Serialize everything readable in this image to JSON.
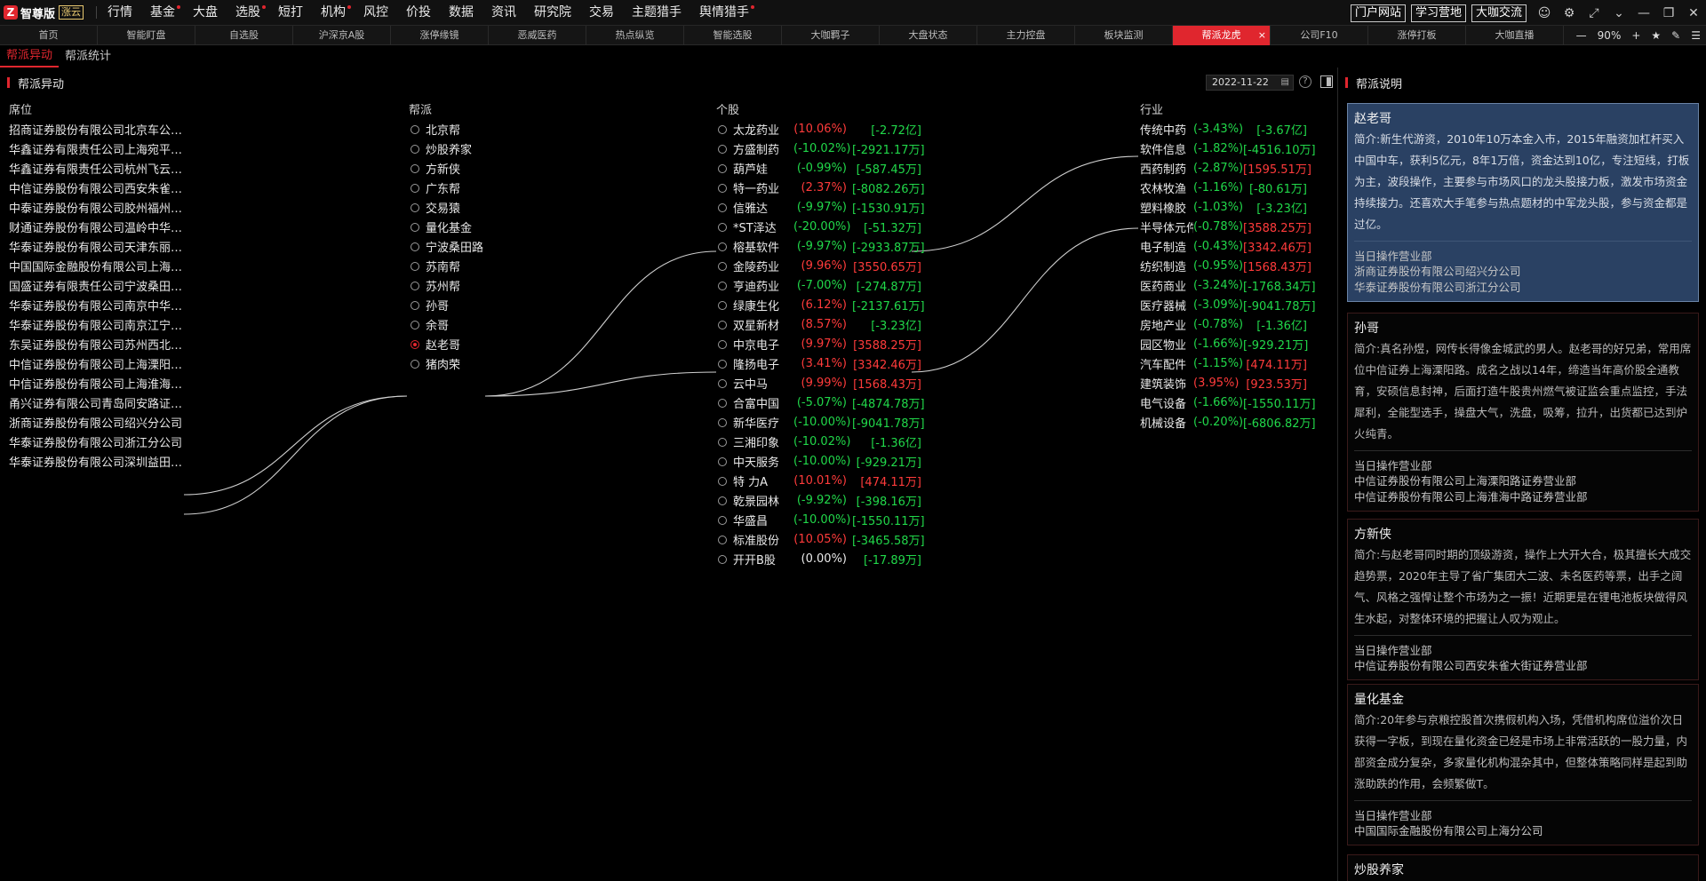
{
  "app": {
    "name": "智尊版",
    "badge": "涨云"
  },
  "menu": [
    {
      "label": "行情",
      "dot": false
    },
    {
      "label": "基金",
      "dot": true
    },
    {
      "label": "大盘",
      "dot": false
    },
    {
      "label": "选股",
      "dot": true
    },
    {
      "label": "短打",
      "dot": false
    },
    {
      "label": "机构",
      "dot": true
    },
    {
      "label": "风控",
      "dot": false
    },
    {
      "label": "价投",
      "dot": false
    },
    {
      "label": "数据",
      "dot": false
    },
    {
      "label": "资讯",
      "dot": false
    },
    {
      "label": "研究院",
      "dot": false
    },
    {
      "label": "交易",
      "dot": false
    },
    {
      "label": "主题猎手",
      "dot": false
    },
    {
      "label": "舆情猎手",
      "dot": true
    }
  ],
  "top_links": [
    "门户网站",
    "学习营地",
    "大咖交流"
  ],
  "tabs": [
    "首页",
    "智能盯盘",
    "自选股",
    "沪深京A股",
    "涨停缘镜",
    "恶威医药",
    "热点纵览",
    "智能选股",
    "大咖羁子",
    "大盘状态",
    "主力控盘",
    "板块监测",
    "帮派龙虎",
    "公司F10",
    "涨停打板",
    "大咖直播"
  ],
  "active_tab": "帮派龙虎",
  "zoom": "90%",
  "subtabs": [
    "帮派异动",
    "帮派统计"
  ],
  "left_panel": {
    "title": "帮派异动",
    "date": "2022-11-22"
  },
  "columns": {
    "seat": "席位",
    "gang": "帮派",
    "stock": "个股",
    "industry": "行业"
  },
  "seats": [
    "招商证券股份有限公司北京车公庄西路证券营业部",
    "华鑫证券有限责任公司上海宛平南路证券营业部",
    "华鑫证券有限责任公司杭州飞云江路证券营业部",
    "中信证券股份有限公司西安朱雀大街证券营业部",
    "中泰证券股份有限公司胶州福州支路证券营业部",
    "财通证券股份有限公司温岭中华路证券营业部",
    "华泰证券股份有限公司天津东丽开发区二纬路证券营业部",
    "中国国际金融股份有限公司上海分公司",
    "国盛证券有限责任公司宁波桑田路证券营业部",
    "华泰证券股份有限公司南京中华路证券营业部",
    "华泰证券股份有限公司南京江宁天元东路证券营业部",
    "东吴证券股份有限公司苏州西北街证券营业部",
    "中信证券股份有限公司上海溧阳路证券营业部",
    "中信证券股份有限公司上海淮海中路证券营业部",
    "甬兴证券有限公司青岛同安路证券营业部",
    "浙商证券股份有限公司绍兴分公司",
    "华泰证券股份有限公司浙江分公司",
    "华泰证券股份有限公司深圳益田路荣超商务中心证券营业部"
  ],
  "gangs": [
    "北京帮",
    "炒股养家",
    "方新侠",
    "广东帮",
    "交易猿",
    "量化基金",
    "宁波桑田路",
    "苏南帮",
    "苏州帮",
    "孙哥",
    "余哥",
    "赵老哥",
    "猪肉荣"
  ],
  "selected_gang": "赵老哥",
  "stocks": [
    {
      "name": "太龙药业",
      "pct": "(10.06%)",
      "amt": "[-2.72亿]",
      "pc": "red",
      "ac": "green"
    },
    {
      "name": "方盛制药",
      "pct": "(-10.02%)",
      "amt": "[-2921.17万]",
      "pc": "green",
      "ac": "green"
    },
    {
      "name": "葫芦娃",
      "pct": "(-0.99%)",
      "amt": "[-587.45万]",
      "pc": "green",
      "ac": "green"
    },
    {
      "name": "特一药业",
      "pct": "(2.37%)",
      "amt": "[-8082.26万]",
      "pc": "red",
      "ac": "green"
    },
    {
      "name": "信雅达",
      "pct": "(-9.97%)",
      "amt": "[-1530.91万]",
      "pc": "green",
      "ac": "green"
    },
    {
      "name": "*ST泽达",
      "pct": "(-20.00%)",
      "amt": "[-51.32万]",
      "pc": "green",
      "ac": "green"
    },
    {
      "name": "榕基软件",
      "pct": "(-9.97%)",
      "amt": "[-2933.87万]",
      "pc": "green",
      "ac": "green"
    },
    {
      "name": "金陵药业",
      "pct": "(9.96%)",
      "amt": "[3550.65万]",
      "pc": "red",
      "ac": "red"
    },
    {
      "name": "亨迪药业",
      "pct": "(-7.00%)",
      "amt": "[-274.87万]",
      "pc": "green",
      "ac": "green"
    },
    {
      "name": "绿康生化",
      "pct": "(6.12%)",
      "amt": "[-2137.61万]",
      "pc": "red",
      "ac": "green"
    },
    {
      "name": "双星新材",
      "pct": "(8.57%)",
      "amt": "[-3.23亿]",
      "pc": "red",
      "ac": "green"
    },
    {
      "name": "中京电子",
      "pct": "(9.97%)",
      "amt": "[3588.25万]",
      "pc": "red",
      "ac": "red"
    },
    {
      "name": "隆扬电子",
      "pct": "(3.41%)",
      "amt": "[3342.46万]",
      "pc": "red",
      "ac": "red"
    },
    {
      "name": "云中马",
      "pct": "(9.99%)",
      "amt": "[1568.43万]",
      "pc": "red",
      "ac": "red"
    },
    {
      "name": "合富中国",
      "pct": "(-5.07%)",
      "amt": "[-4874.78万]",
      "pc": "green",
      "ac": "green"
    },
    {
      "name": "新华医疗",
      "pct": "(-10.00%)",
      "amt": "[-9041.78万]",
      "pc": "green",
      "ac": "green"
    },
    {
      "name": "三湘印象",
      "pct": "(-10.02%)",
      "amt": "[-1.36亿]",
      "pc": "green",
      "ac": "green"
    },
    {
      "name": "中天服务",
      "pct": "(-10.00%)",
      "amt": "[-929.21万]",
      "pc": "green",
      "ac": "green"
    },
    {
      "name": "特 力A",
      "pct": "(10.01%)",
      "amt": "[474.11万]",
      "pc": "red",
      "ac": "red"
    },
    {
      "name": "乾景园林",
      "pct": "(-9.92%)",
      "amt": "[-398.16万]",
      "pc": "green",
      "ac": "green"
    },
    {
      "name": "华盛昌",
      "pct": "(-10.00%)",
      "amt": "[-1550.11万]",
      "pc": "green",
      "ac": "green"
    },
    {
      "name": "标准股份",
      "pct": "(10.05%)",
      "amt": "[-3465.58万]",
      "pc": "red",
      "ac": "green"
    },
    {
      "name": "开开B股",
      "pct": "(0.00%)",
      "amt": "[-17.89万]",
      "pc": "white",
      "ac": "green"
    }
  ],
  "industries": [
    {
      "name": "传统中药",
      "pct": "(-3.43%)",
      "amt": "[-3.67亿]",
      "pc": "green",
      "ac": "green"
    },
    {
      "name": "软件信息",
      "pct": "(-1.82%)",
      "amt": "[-4516.10万]",
      "pc": "green",
      "ac": "green"
    },
    {
      "name": "西药制药",
      "pct": "(-2.87%)",
      "amt": "[1595.51万]",
      "pc": "green",
      "ac": "red"
    },
    {
      "name": "农林牧渔",
      "pct": "(-1.16%)",
      "amt": "[-80.61万]",
      "pc": "green",
      "ac": "green"
    },
    {
      "name": "塑料橡胶",
      "pct": "(-1.03%)",
      "amt": "[-3.23亿]",
      "pc": "green",
      "ac": "green"
    },
    {
      "name": "半导体元件",
      "pct": "(-0.78%)",
      "amt": "[3588.25万]",
      "pc": "green",
      "ac": "red"
    },
    {
      "name": "电子制造",
      "pct": "(-0.43%)",
      "amt": "[3342.46万]",
      "pc": "green",
      "ac": "red"
    },
    {
      "name": "纺织制造",
      "pct": "(-0.95%)",
      "amt": "[1568.43万]",
      "pc": "green",
      "ac": "red"
    },
    {
      "name": "医药商业",
      "pct": "(-3.24%)",
      "amt": "[-1768.34万]",
      "pc": "green",
      "ac": "green"
    },
    {
      "name": "医疗器械",
      "pct": "(-3.09%)",
      "amt": "[-9041.78万]",
      "pc": "green",
      "ac": "green"
    },
    {
      "name": "房地产业",
      "pct": "(-0.78%)",
      "amt": "[-1.36亿]",
      "pc": "green",
      "ac": "green"
    },
    {
      "name": "园区物业",
      "pct": "(-1.66%)",
      "amt": "[-929.21万]",
      "pc": "green",
      "ac": "green"
    },
    {
      "name": "汽车配件",
      "pct": "(-1.15%)",
      "amt": "[474.11万]",
      "pc": "green",
      "ac": "red"
    },
    {
      "name": "建筑装饰",
      "pct": "(3.95%)",
      "amt": "[923.53万]",
      "pc": "red",
      "ac": "red"
    },
    {
      "name": "电气设备",
      "pct": "(-1.66%)",
      "amt": "[-1550.11万]",
      "pc": "green",
      "ac": "green"
    },
    {
      "name": "机械设备",
      "pct": "(-0.20%)",
      "amt": "[-6806.82万]",
      "pc": "green",
      "ac": "green"
    }
  ],
  "right_panel": {
    "title": "帮派说明"
  },
  "cards": [
    {
      "name": "赵老哥",
      "desc": "简介:新生代游资，2010年10万本金入市，2015年融资加杠杆买入中国中车，获利5亿元，8年1万倍，资金达到10亿，专注短线，打板为主，波段操作，主要参与市场风口的龙头股接力板，激发市场资金持续接力。还喜欢大手笔参与热点题材的中军龙头股，参与资金都是过亿。",
      "sub": "当日操作营业部",
      "depts": [
        "浙商证券股份有限公司绍兴分公司",
        "华泰证券股份有限公司浙江分公司"
      ]
    },
    {
      "name": "孙哥",
      "desc": "简介:真名孙煜，网传长得像金城武的男人。赵老哥的好兄弟，常用席位中信证券上海溧阳路。成名之战以14年，缔造当年高价股全通教育，安硕信息封神，后面打造牛股贵州燃气被证监会重点监控，手法犀利，全能型选手，操盘大气，洗盘，吸筹，拉升，出货都已达到炉火纯青。",
      "sub": "当日操作营业部",
      "depts": [
        "中信证券股份有限公司上海溧阳路证券营业部",
        "中信证券股份有限公司上海淮海中路证券营业部"
      ]
    },
    {
      "name": "方新侠",
      "desc": "简介:与赵老哥同时期的顶级游资，操作上大开大合，极其擅长大成交趋势票，2020年主导了省广集团大二波、未名医药等票，出手之阔气、风格之强悍让整个市场为之一振！近期更是在锂电池板块做得风生水起，对整体环境的把握让人叹为观止。",
      "sub": "当日操作营业部",
      "depts": [
        "中信证券股份有限公司西安朱雀大街证券营业部"
      ]
    },
    {
      "name": "量化基金",
      "desc": "简介:20年参与京粮控股首次携假机构入场，凭借机构席位溢价次日获得一字板，到现在量化资金已经是市场上非常活跃的一股力量，内部资金成分复杂，多家量化机构混杂其中，但整体策略同样是起到助涨助跌的作用，会频繁做T。",
      "sub": "当日操作营业部",
      "depts": [
        "中国国际金融股份有限公司上海分公司"
      ]
    },
    {
      "name": "炒股养家",
      "desc": "",
      "sub": "",
      "depts": []
    }
  ]
}
